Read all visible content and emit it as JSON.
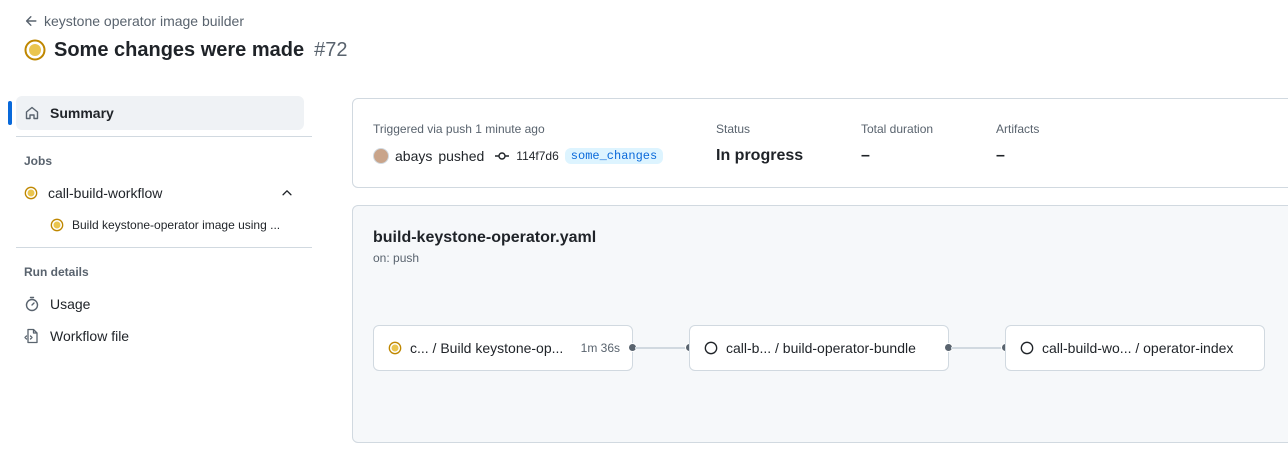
{
  "breadcrumb": {
    "back_label": "keystone operator image builder"
  },
  "header": {
    "title": "Some changes were made",
    "run_number": "#72"
  },
  "sidebar": {
    "summary_label": "Summary",
    "jobs_heading": "Jobs",
    "jobs": [
      {
        "label": "call-build-workflow",
        "children": [
          "Build keystone-operator image using ..."
        ]
      }
    ],
    "run_details_heading": "Run details",
    "details": [
      {
        "label": "Usage",
        "icon": "stopwatch-icon"
      },
      {
        "label": "Workflow file",
        "icon": "file-code-icon"
      }
    ]
  },
  "run_info": {
    "trigger_text": "Triggered via push 1 minute ago",
    "actor": "abays",
    "action": "pushed",
    "commit_sha": "114f7d6",
    "branch": "some_changes",
    "status_label": "Status",
    "status_value": "In progress",
    "duration_label": "Total duration",
    "duration_value": "–",
    "artifacts_label": "Artifacts",
    "artifacts_value": "–"
  },
  "workflow": {
    "name": "build-keystone-operator.yaml",
    "trigger": "on: push",
    "jobs": [
      {
        "label": "c... / Build keystone-op...",
        "status": "in-progress",
        "duration": "1m 36s"
      },
      {
        "label": "call-b... / build-operator-bundle",
        "status": "queued",
        "duration": ""
      },
      {
        "label": "call-build-wo... / operator-index",
        "status": "queued",
        "duration": ""
      }
    ]
  },
  "colors": {
    "in_progress": "#bf8700",
    "accent": "#0969da",
    "muted": "#59636e",
    "border": "#d1d9e0"
  }
}
